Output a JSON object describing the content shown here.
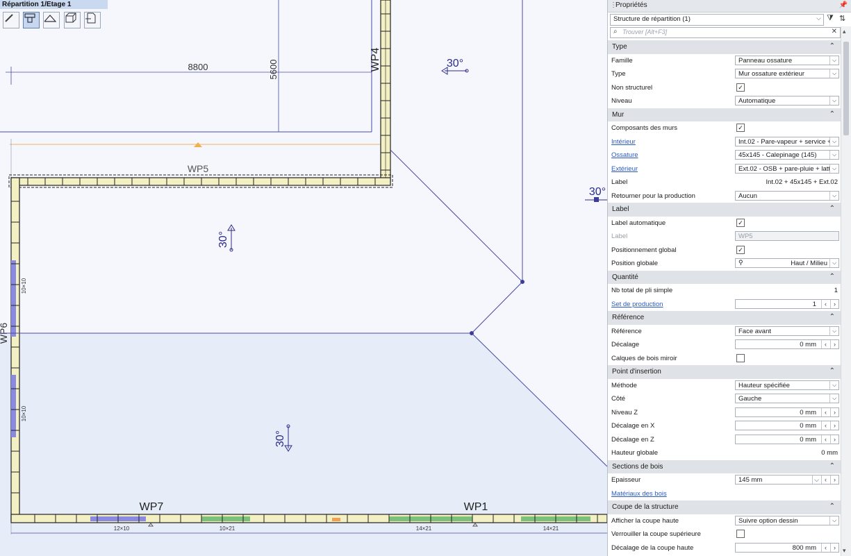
{
  "canvas": {
    "view_title": "Répartition 1/Etage 1",
    "tools": [
      {
        "icon": "pencil-icon"
      },
      {
        "icon": "wall-distribution-icon"
      },
      {
        "icon": "roof-icon"
      },
      {
        "icon": "3d-box-icon"
      },
      {
        "icon": "document-export-icon"
      }
    ],
    "dims": {
      "d1": "8800",
      "d2": "5600"
    },
    "wall_labels": {
      "wp4": "WP4",
      "wp5": "WP5",
      "wp7": "WP7",
      "wp1": "WP1",
      "wp6": "WP6"
    },
    "slopes": {
      "s1": "30°",
      "s2": "30°",
      "s3": "30°",
      "s4": "30°"
    },
    "sections": {
      "a": "10×10",
      "b": "10×10",
      "c": "12×10",
      "d": "10×21",
      "e": "14×21",
      "f": "14×21"
    }
  },
  "panel": {
    "title": "Propriétés",
    "selector": "Structure de répartition (1)",
    "search_placeholder": "Trouver [Alt+F3]",
    "rows": [
      {
        "kind": "section",
        "label": "Type"
      },
      {
        "kind": "dropdown",
        "label": "Famille",
        "value": "Panneau ossature"
      },
      {
        "kind": "dropdown",
        "label": "Type",
        "value": "Mur ossature extérieur"
      },
      {
        "kind": "check",
        "label": "Non structurel",
        "checked": "✓"
      },
      {
        "kind": "dropdown",
        "label": "Niveau",
        "value": "Automatique"
      },
      {
        "kind": "section",
        "label": "Mur"
      },
      {
        "kind": "check",
        "label": "Composants des murs",
        "checked": "✓"
      },
      {
        "kind": "dropdown",
        "label": "Intérieur",
        "link": true,
        "value": "Int.02 - Pare-vapeur + service +"
      },
      {
        "kind": "dropdown",
        "label": "Ossature",
        "link": true,
        "value": "45x145 - Calepinage (145)"
      },
      {
        "kind": "dropdown",
        "label": "Extérieur",
        "link": true,
        "value": "Ext.02 - OSB + pare-pluie + latt"
      },
      {
        "kind": "text",
        "label": "Label",
        "value": "Int.02 + 45x145 + Ext.02"
      },
      {
        "kind": "dropdown",
        "label": "Retourner pour la production",
        "value": "Aucun"
      },
      {
        "kind": "section",
        "label": "Label"
      },
      {
        "kind": "check",
        "label": "Label automatique",
        "checked": "✓"
      },
      {
        "kind": "disabled",
        "label": "Label",
        "value": "WP5"
      },
      {
        "kind": "check",
        "label": "Positionnement global",
        "checked": "✓"
      },
      {
        "kind": "dropdown-right",
        "label": "Position globale",
        "value": "Haut / Milieu"
      },
      {
        "kind": "section",
        "label": "Quantité"
      },
      {
        "kind": "text",
        "label": "Nb total de pli simple",
        "value": "1"
      },
      {
        "kind": "spin",
        "label": "Set de production",
        "link": true,
        "value": "1"
      },
      {
        "kind": "section",
        "label": "Référence"
      },
      {
        "kind": "dropdown",
        "label": "Référence",
        "value": "Face avant"
      },
      {
        "kind": "spin",
        "label": "Décalage",
        "value": "0 mm"
      },
      {
        "kind": "check",
        "label": "Calques de bois miroir",
        "checked": ""
      },
      {
        "kind": "section",
        "label": "Point d'insertion"
      },
      {
        "kind": "dropdown",
        "label": "Méthode",
        "value": "Hauteur spécifiée"
      },
      {
        "kind": "dropdown",
        "label": "Côté",
        "value": "Gauche"
      },
      {
        "kind": "spin",
        "label": "Niveau Z",
        "value": "0 mm"
      },
      {
        "kind": "spin",
        "label": "Décalage en X",
        "value": "0 mm"
      },
      {
        "kind": "spin",
        "label": "Décalage en Z",
        "value": "0 mm"
      },
      {
        "kind": "text",
        "label": "Hauteur globale",
        "value": "0 mm"
      },
      {
        "kind": "section",
        "label": "Sections de bois"
      },
      {
        "kind": "dropspin",
        "label": "Epaisseur",
        "value": "145 mm"
      },
      {
        "kind": "linkonly",
        "label": "Matériaux des bois",
        "link": true
      },
      {
        "kind": "section",
        "label": "Coupe de la structure"
      },
      {
        "kind": "dropdown",
        "label": "Afficher la coupe haute",
        "value": "Suivre option dessin"
      },
      {
        "kind": "check",
        "label": "Verrouiller la coupe supérieure",
        "checked": ""
      },
      {
        "kind": "spin",
        "label": "Décalage de la coupe haute",
        "value": "800 mm"
      }
    ]
  },
  "colors": {
    "line": "#3c3ca0",
    "wall_fill": "#f3f0c4",
    "section_bg": "#dfe2e6",
    "link": "#2b59c3",
    "floor": "#e6edf8"
  }
}
